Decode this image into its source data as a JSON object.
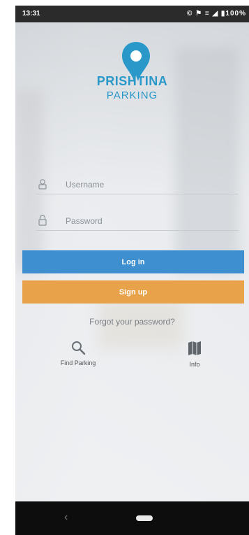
{
  "status_bar": {
    "time": "13:31",
    "icons_text": "© ⚑ ≡ ◢ ▮100%"
  },
  "brand": {
    "line1": "PRISHTINA",
    "line2": "PARKING",
    "color": "#2a98c9"
  },
  "form": {
    "username_placeholder": "Username",
    "password_placeholder": "Password"
  },
  "buttons": {
    "login_label": "Log in",
    "signup_label": "Sign up",
    "login_color": "#3d8fcf",
    "signup_color": "#e8a24a"
  },
  "links": {
    "forgot": "Forgot your password?"
  },
  "quick_actions": {
    "find_parking": {
      "label": "Find Parking",
      "icon": "search-icon"
    },
    "info": {
      "label": "Info",
      "icon": "map-icon"
    }
  },
  "nav": {
    "back_icon": "back-icon",
    "home_icon": "home-pill-icon"
  }
}
